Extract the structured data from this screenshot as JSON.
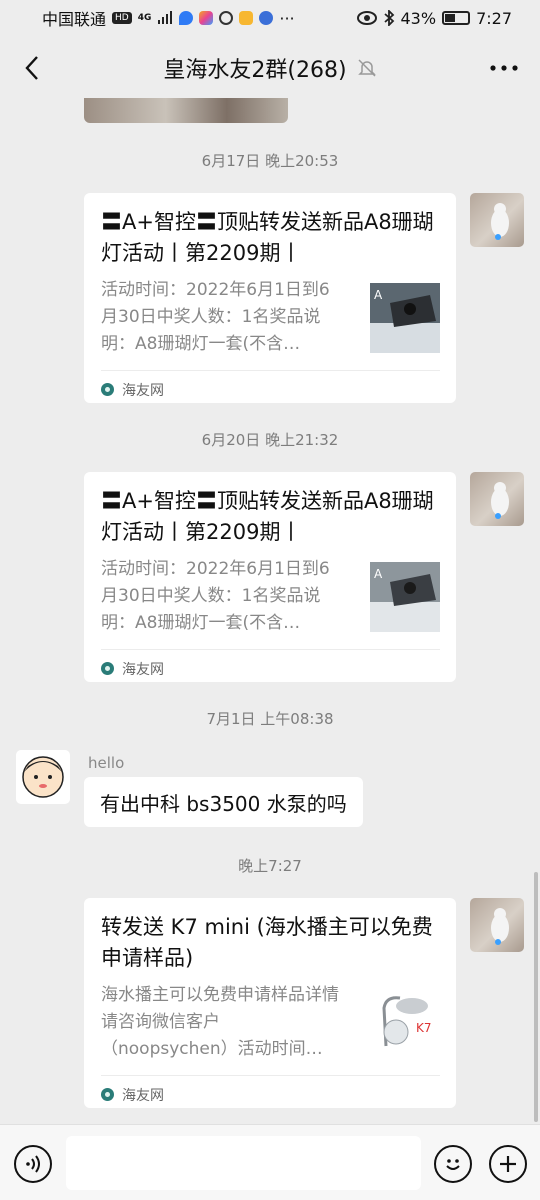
{
  "status_bar": {
    "carrier": "中国联通",
    "hd": "HD",
    "signal": "4G",
    "battery_pct": "43%",
    "time": "7:27",
    "more": "···"
  },
  "header": {
    "title": "皇海水友2群(268)",
    "back_icon": "chevron-left-icon",
    "mute_icon": "bell-off-icon",
    "more_icon": "more-dots-icon"
  },
  "messages": [
    {
      "time": "6月17日 晚上20:53",
      "card_title": "〓A+智控〓顶贴转发送新品A8珊瑚灯活动丨第2209期丨",
      "card_desc": "活动时间：2022年6月1日到6月30日中奖人数：1名奖品说明：A8珊瑚灯一套(不含…",
      "source": "海友网"
    },
    {
      "time": "6月20日 晚上21:32",
      "card_title": "〓A+智控〓顶贴转发送新品A8珊瑚灯活动丨第2209期丨",
      "card_desc": "活动时间：2022年6月1日到6月30日中奖人数：1名奖品说明：A8珊瑚灯一套(不含…",
      "source": "海友网"
    },
    {
      "time": "7月1日 上午08:38",
      "sender": "hello",
      "text": "有出中科 bs3500 水泵的吗"
    },
    {
      "time": "晚上7:27",
      "card_title": "转发送 K7 mini (海水播主可以免费申请样品)",
      "card_desc": "海水播主可以免费申请样品详情请咨询微信客户（noopsychen）活动时间…",
      "source": "海友网"
    }
  ],
  "input_bar": {
    "voice_icon": "voice-icon",
    "emoji_icon": "emoji-icon",
    "plus_icon": "plus-icon"
  },
  "colors": {
    "background": "#ededed",
    "bubble": "#ffffff",
    "time_text": "#7d7d7d",
    "desc_text": "#888888"
  }
}
